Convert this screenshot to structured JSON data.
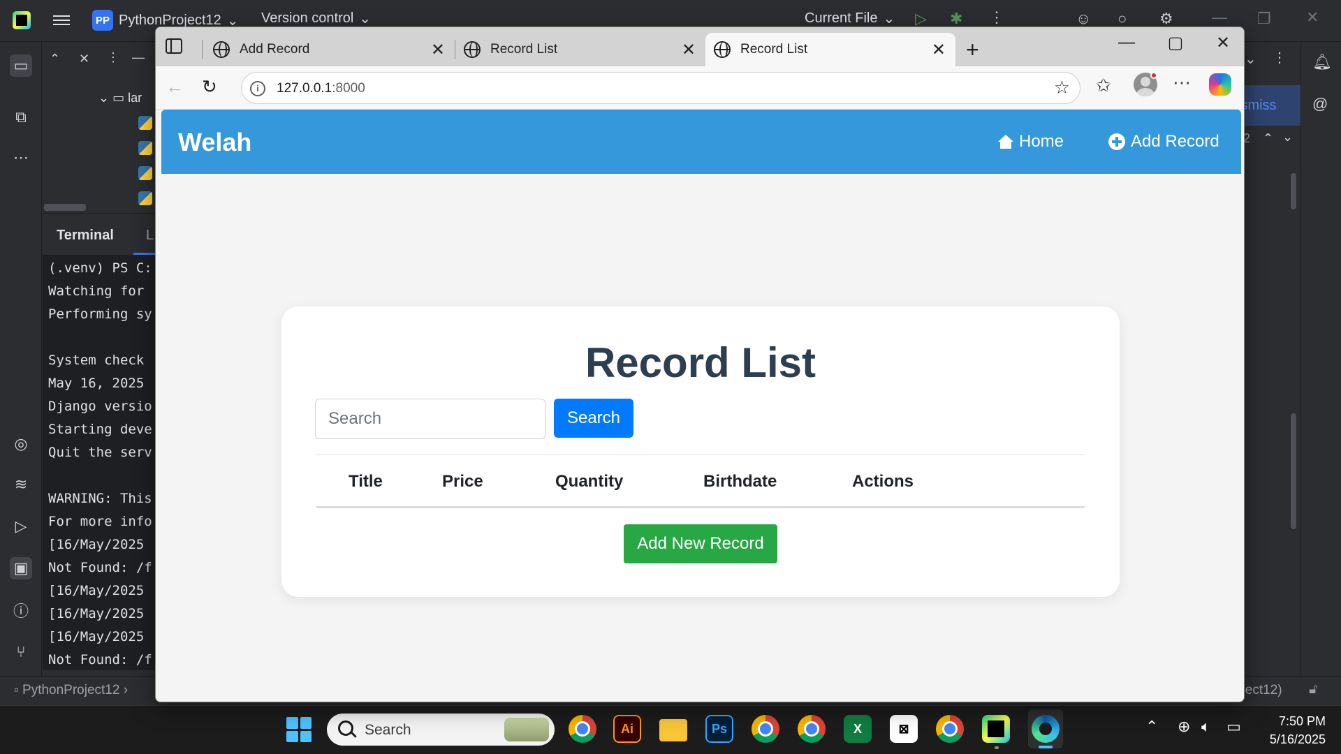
{
  "ide": {
    "project_badge": "PP",
    "project_name": "PythonProject12",
    "version_control": "Version control",
    "run_config": "Current File",
    "tree_folder": "lar",
    "terminal_tab": "Terminal",
    "terminal_tab_other": "L",
    "terminal_lines": [
      "(.venv) PS C:",
      "Watching for",
      "Performing sy",
      "",
      "System check",
      "May 16, 2025",
      "Django versio",
      "Starting deve",
      "Quit the serv",
      "",
      "WARNING: This",
      "For more info",
      "[16/May/2025",
      "Not Found: /f",
      "[16/May/2025",
      "[16/May/2025",
      "[16/May/2025",
      "Not Found: /f"
    ],
    "dismiss_text": "ismiss",
    "side_number": "2",
    "status_left": "PythonProject12",
    "status_right": "oject12)"
  },
  "browser": {
    "tabs": [
      {
        "title": "Add Record",
        "active": false
      },
      {
        "title": "Record List",
        "active": false
      },
      {
        "title": "Record List",
        "active": true
      }
    ],
    "url_host": "127.0.0.1",
    "url_port": ":8000"
  },
  "site": {
    "brand": "Welah",
    "nav": {
      "home": "Home",
      "add_record": "Add Record"
    },
    "page_title": "Record List",
    "search": {
      "placeholder": "Search",
      "button": "Search"
    },
    "table_headers": [
      "Title",
      "Price",
      "Quantity",
      "Birthdate",
      "Actions"
    ],
    "add_new_button": "Add New Record"
  },
  "taskbar": {
    "search_label": "Search",
    "time": "7:50 PM",
    "date": "5/16/2025"
  },
  "colors": {
    "navbar": "#3498db",
    "primary_button": "#007bff",
    "success_button": "#28a745",
    "heading": "#2c3e50"
  }
}
